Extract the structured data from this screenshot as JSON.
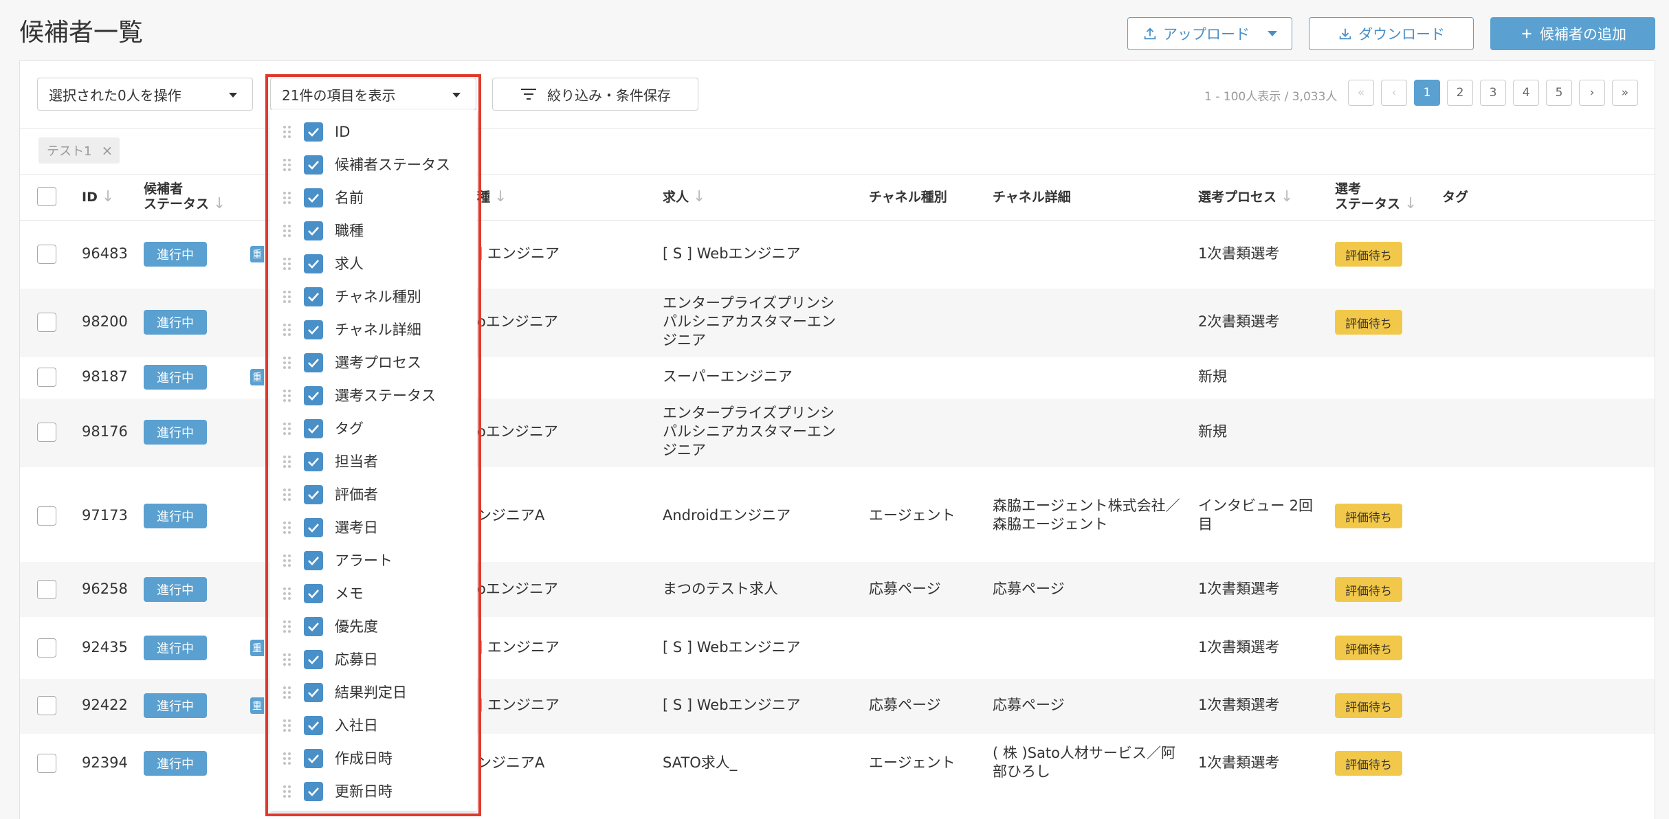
{
  "page": {
    "title": "候補者一覧"
  },
  "header": {
    "upload_label": "アップロード",
    "download_label": "ダウンロード",
    "add_label": "候補者の追加"
  },
  "toolbar": {
    "bulk_action": "選択された0人を操作",
    "columns_select": "21件の項目を表示",
    "filter_label": "絞り込み・条件保存",
    "pagination_info": "1 - 100人表示 / 3,033人",
    "pages": [
      "1",
      "2",
      "3",
      "4",
      "5"
    ],
    "current_page": "1"
  },
  "filter_tag": {
    "label": "テスト1"
  },
  "table": {
    "headers": {
      "id": "ID",
      "status_line1": "候補者",
      "status_line2": "ステータス",
      "job_type_partial": "種",
      "job": "求人",
      "channel_type": "チャネル種別",
      "channel_detail": "チャネル詳細",
      "process": "選考プロセス",
      "sel_status_line1": "選考",
      "sel_status_line2": "ステータス",
      "tag": "タグ"
    },
    "rows": [
      {
        "id": "96483",
        "status": "進行中",
        "dup": "重",
        "job_type": "] エンジニア",
        "job": "[ S ] Webエンジニア",
        "channel_type": "",
        "channel_detail": "",
        "process": "1次書類選考",
        "sel_status": "評価待ち"
      },
      {
        "id": "98200",
        "status": "進行中",
        "dup": "",
        "job_type": "oエンジニア",
        "job": "エンタープライズプリンシパルシニアカスタマーエンジニア",
        "channel_type": "",
        "channel_detail": "",
        "process": "2次書類選考",
        "sel_status": "評価待ち"
      },
      {
        "id": "98187",
        "status": "進行中",
        "dup": "重",
        "job_type": "",
        "job": "スーパーエンジニア",
        "channel_type": "",
        "channel_detail": "",
        "process": "新規",
        "sel_status": ""
      },
      {
        "id": "98176",
        "status": "進行中",
        "dup": "",
        "job_type": "oエンジニア",
        "job": "エンタープライズプリンシパルシニアカスタマーエンジニア",
        "channel_type": "",
        "channel_detail": "",
        "process": "新規",
        "sel_status": ""
      },
      {
        "id": "97173",
        "status": "進行中",
        "dup": "",
        "job_type": "ンジニアA",
        "job": "Androidエンジニア",
        "channel_type": "エージェント",
        "channel_detail": "森脇エージェント株式会社／森脇エージェント",
        "process": "インタビュー 2回目",
        "sel_status": "評価待ち"
      },
      {
        "id": "96258",
        "status": "進行中",
        "dup": "",
        "job_type": "oエンジニア",
        "job": "まつのテスト求人",
        "channel_type": "応募ページ",
        "channel_detail": "応募ページ",
        "process": "1次書類選考",
        "sel_status": "評価待ち"
      },
      {
        "id": "92435",
        "status": "進行中",
        "dup": "重",
        "job_type": "] エンジニア",
        "job": "[ S ] Webエンジニア",
        "channel_type": "",
        "channel_detail": "",
        "process": "1次書類選考",
        "sel_status": "評価待ち"
      },
      {
        "id": "92422",
        "status": "進行中",
        "dup": "重",
        "job_type": "] エンジニア",
        "job": "[ S ] Webエンジニア",
        "channel_type": "応募ページ",
        "channel_detail": "応募ページ",
        "process": "1次書類選考",
        "sel_status": "評価待ち"
      },
      {
        "id": "92394",
        "status": "進行中",
        "dup": "",
        "job_type": "ンジニアA",
        "job": "SATO求人_",
        "channel_type": "エージェント",
        "channel_detail": "( 株 )Sato人材サービス／阿部ひろし",
        "process": "1次書類選考",
        "sel_status": "評価待ち"
      }
    ]
  },
  "column_dropdown": {
    "items": [
      "ID",
      "候補者ステータス",
      "名前",
      "職種",
      "求人",
      "チャネル種別",
      "チャネル詳細",
      "選考プロセス",
      "選考ステータス",
      "タグ",
      "担当者",
      "評価者",
      "選考日",
      "アラート",
      "メモ",
      "優先度",
      "応募日",
      "結果判定日",
      "入社日",
      "作成日時",
      "更新日時"
    ]
  },
  "colors": {
    "accent": "#5aa0d0",
    "highlight": "#e0392b",
    "pending": "#f2c84b"
  }
}
